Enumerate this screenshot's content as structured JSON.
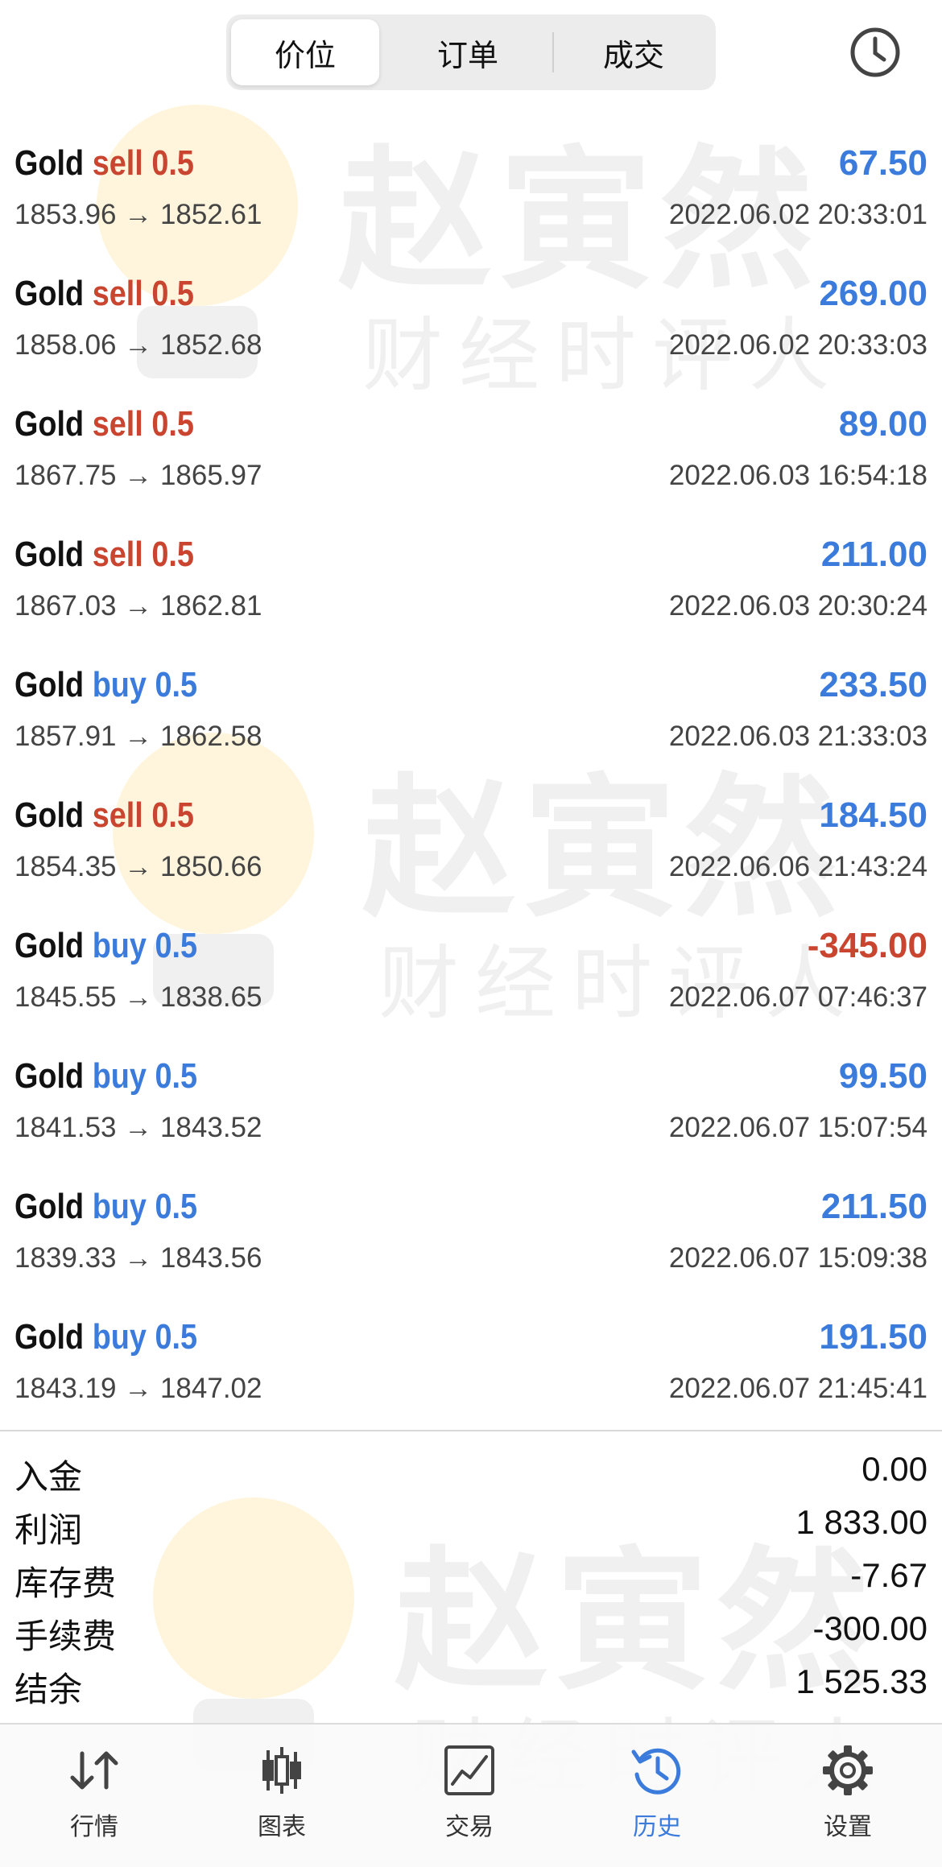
{
  "header": {
    "tabs": [
      {
        "label": "价位",
        "active": true
      },
      {
        "label": "订单",
        "active": false
      },
      {
        "label": "成交",
        "active": false
      }
    ],
    "history_icon": "clock-icon"
  },
  "deals": [
    {
      "symbol": "Gold",
      "side": "sell",
      "volume": "0.5",
      "prices": "1853.96 → 1852.61",
      "profit": "67.50",
      "time": "2022.06.02 20:33:01"
    },
    {
      "symbol": "Gold",
      "side": "sell",
      "volume": "0.5",
      "prices": "1858.06 → 1852.68",
      "profit": "269.00",
      "time": "2022.06.02 20:33:03"
    },
    {
      "symbol": "Gold",
      "side": "sell",
      "volume": "0.5",
      "prices": "1867.75 → 1865.97",
      "profit": "89.00",
      "time": "2022.06.03 16:54:18"
    },
    {
      "symbol": "Gold",
      "side": "sell",
      "volume": "0.5",
      "prices": "1867.03 → 1862.81",
      "profit": "211.00",
      "time": "2022.06.03 20:30:24"
    },
    {
      "symbol": "Gold",
      "side": "buy",
      "volume": "0.5",
      "prices": "1857.91 → 1862.58",
      "profit": "233.50",
      "time": "2022.06.03 21:33:03"
    },
    {
      "symbol": "Gold",
      "side": "sell",
      "volume": "0.5",
      "prices": "1854.35 → 1850.66",
      "profit": "184.50",
      "time": "2022.06.06 21:43:24"
    },
    {
      "symbol": "Gold",
      "side": "buy",
      "volume": "0.5",
      "prices": "1845.55 → 1838.65",
      "profit": "-345.00",
      "time": "2022.06.07 07:46:37"
    },
    {
      "symbol": "Gold",
      "side": "buy",
      "volume": "0.5",
      "prices": "1841.53 → 1843.52",
      "profit": "99.50",
      "time": "2022.06.07 15:07:54"
    },
    {
      "symbol": "Gold",
      "side": "buy",
      "volume": "0.5",
      "prices": "1839.33 → 1843.56",
      "profit": "211.50",
      "time": "2022.06.07 15:09:38"
    },
    {
      "symbol": "Gold",
      "side": "buy",
      "volume": "0.5",
      "prices": "1843.19 → 1847.02",
      "profit": "191.50",
      "time": "2022.06.07 21:45:41"
    }
  ],
  "summary": [
    {
      "label": "入金",
      "value": "0.00"
    },
    {
      "label": "利润",
      "value": "1 833.00"
    },
    {
      "label": "库存费",
      "value": "-7.67"
    },
    {
      "label": "手续费",
      "value": "-300.00"
    },
    {
      "label": "结余",
      "value": "1 525.33"
    }
  ],
  "tabbar": [
    {
      "label": "行情",
      "icon": "quotes-arrows-icon",
      "active": false
    },
    {
      "label": "图表",
      "icon": "candlestick-chart-icon",
      "active": false
    },
    {
      "label": "交易",
      "icon": "trade-chart-icon",
      "active": false
    },
    {
      "label": "历史",
      "icon": "history-clock-icon",
      "active": true
    },
    {
      "label": "设置",
      "icon": "gear-icon",
      "active": false
    }
  ],
  "watermark": {
    "title": "赵寅然",
    "subtitle": "财经时评人"
  },
  "colors": {
    "sell": "#c9452f",
    "buy": "#3a7bdc",
    "profit_positive": "#3a7bdc",
    "profit_negative": "#c9452f",
    "active_tab": "#3a7bdc"
  }
}
